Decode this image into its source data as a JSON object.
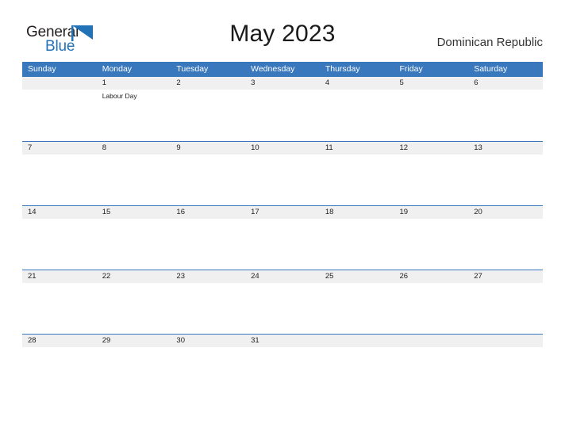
{
  "logo": {
    "text_primary": "General",
    "text_secondary": "Blue",
    "triangle_icon": "blue-triangle-flag-icon",
    "primary_color": "#231f20",
    "secondary_color": "#2272b8"
  },
  "header": {
    "title": "May 2023",
    "country": "Dominican Republic"
  },
  "colors": {
    "header_bar": "#3a78bd",
    "day_band": "#f0f0f0",
    "row_divider": "#3a78bd",
    "page_background": "#ffffff",
    "text": "#222222",
    "header_text": "#ffffff"
  },
  "calendar": {
    "month": "May",
    "year": "2023",
    "weekday_headers": [
      "Sunday",
      "Monday",
      "Tuesday",
      "Wednesday",
      "Thursday",
      "Friday",
      "Saturday"
    ],
    "weeks": [
      {
        "days": [
          {
            "number": "",
            "event": ""
          },
          {
            "number": "1",
            "event": "Labour Day"
          },
          {
            "number": "2",
            "event": ""
          },
          {
            "number": "3",
            "event": ""
          },
          {
            "number": "4",
            "event": ""
          },
          {
            "number": "5",
            "event": ""
          },
          {
            "number": "6",
            "event": ""
          }
        ]
      },
      {
        "days": [
          {
            "number": "7",
            "event": ""
          },
          {
            "number": "8",
            "event": ""
          },
          {
            "number": "9",
            "event": ""
          },
          {
            "number": "10",
            "event": ""
          },
          {
            "number": "11",
            "event": ""
          },
          {
            "number": "12",
            "event": ""
          },
          {
            "number": "13",
            "event": ""
          }
        ]
      },
      {
        "days": [
          {
            "number": "14",
            "event": ""
          },
          {
            "number": "15",
            "event": ""
          },
          {
            "number": "16",
            "event": ""
          },
          {
            "number": "17",
            "event": ""
          },
          {
            "number": "18",
            "event": ""
          },
          {
            "number": "19",
            "event": ""
          },
          {
            "number": "20",
            "event": ""
          }
        ]
      },
      {
        "days": [
          {
            "number": "21",
            "event": ""
          },
          {
            "number": "22",
            "event": ""
          },
          {
            "number": "23",
            "event": ""
          },
          {
            "number": "24",
            "event": ""
          },
          {
            "number": "25",
            "event": ""
          },
          {
            "number": "26",
            "event": ""
          },
          {
            "number": "27",
            "event": ""
          }
        ]
      },
      {
        "days": [
          {
            "number": "28",
            "event": ""
          },
          {
            "number": "29",
            "event": ""
          },
          {
            "number": "30",
            "event": ""
          },
          {
            "number": "31",
            "event": ""
          },
          {
            "number": "",
            "event": ""
          },
          {
            "number": "",
            "event": ""
          },
          {
            "number": "",
            "event": ""
          }
        ]
      }
    ]
  }
}
